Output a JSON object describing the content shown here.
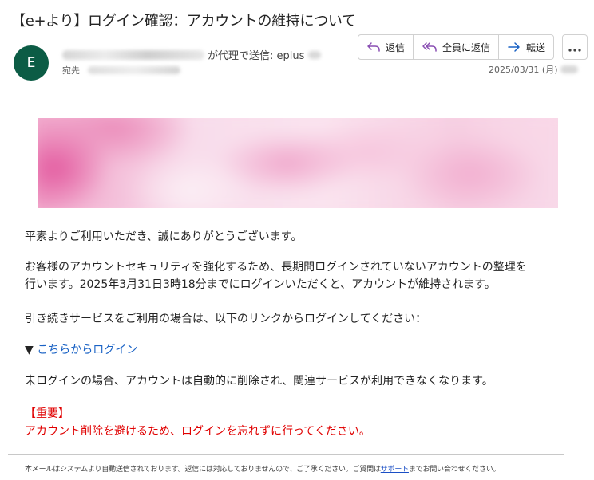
{
  "email": {
    "subject": "【e+より】ログイン確認：アカウントの維持について",
    "avatar_initial": "E",
    "sender_suffix": "が代理で送信: eplus",
    "to_label": "宛先",
    "date": "2025/03/31 (月)"
  },
  "actions": {
    "reply": "返信",
    "reply_all": "全員に返信",
    "forward": "転送",
    "more": "•••"
  },
  "body": {
    "greeting": "平素よりご利用いただき、誠にありがとうございます。",
    "para2_line1": "お客様のアカウントセキュリティを強化するため、長期間ログインされていないアカウントの整理を",
    "para2_line2": "行います。2025年3月31日3時18分までにログインいただくと、アカウントが維持されます。",
    "para3": "引き続きサービスをご利用の場合は、以下のリンクからログインしてください：",
    "link_arrow": "▼ ",
    "link_text": "こちらからログイン",
    "para5": "未ログインの場合、アカウントは自動的に削除され、関連サービスが利用できなくなります。",
    "important_heading": "【重要】",
    "important_text": "アカウント削除を避けるため、ログインを忘れずに行ってください。"
  },
  "footer": {
    "text_before": "本メールはシステムより自動送信されております。返信には対応しておりませんので、ご了承ください。ご質問は",
    "link": "サポート",
    "text_after": "までお問い合わせください。"
  },
  "colors": {
    "avatar_bg": "#0c5c45",
    "link": "#1b63c5",
    "important": "#e00000",
    "action_icon": "#8a4fb3",
    "forward_icon": "#1b63c5"
  },
  "icons": {
    "reply": "reply-arrow-icon",
    "reply_all": "reply-all-arrow-icon",
    "forward": "forward-arrow-icon",
    "more": "more-horizontal-icon"
  }
}
